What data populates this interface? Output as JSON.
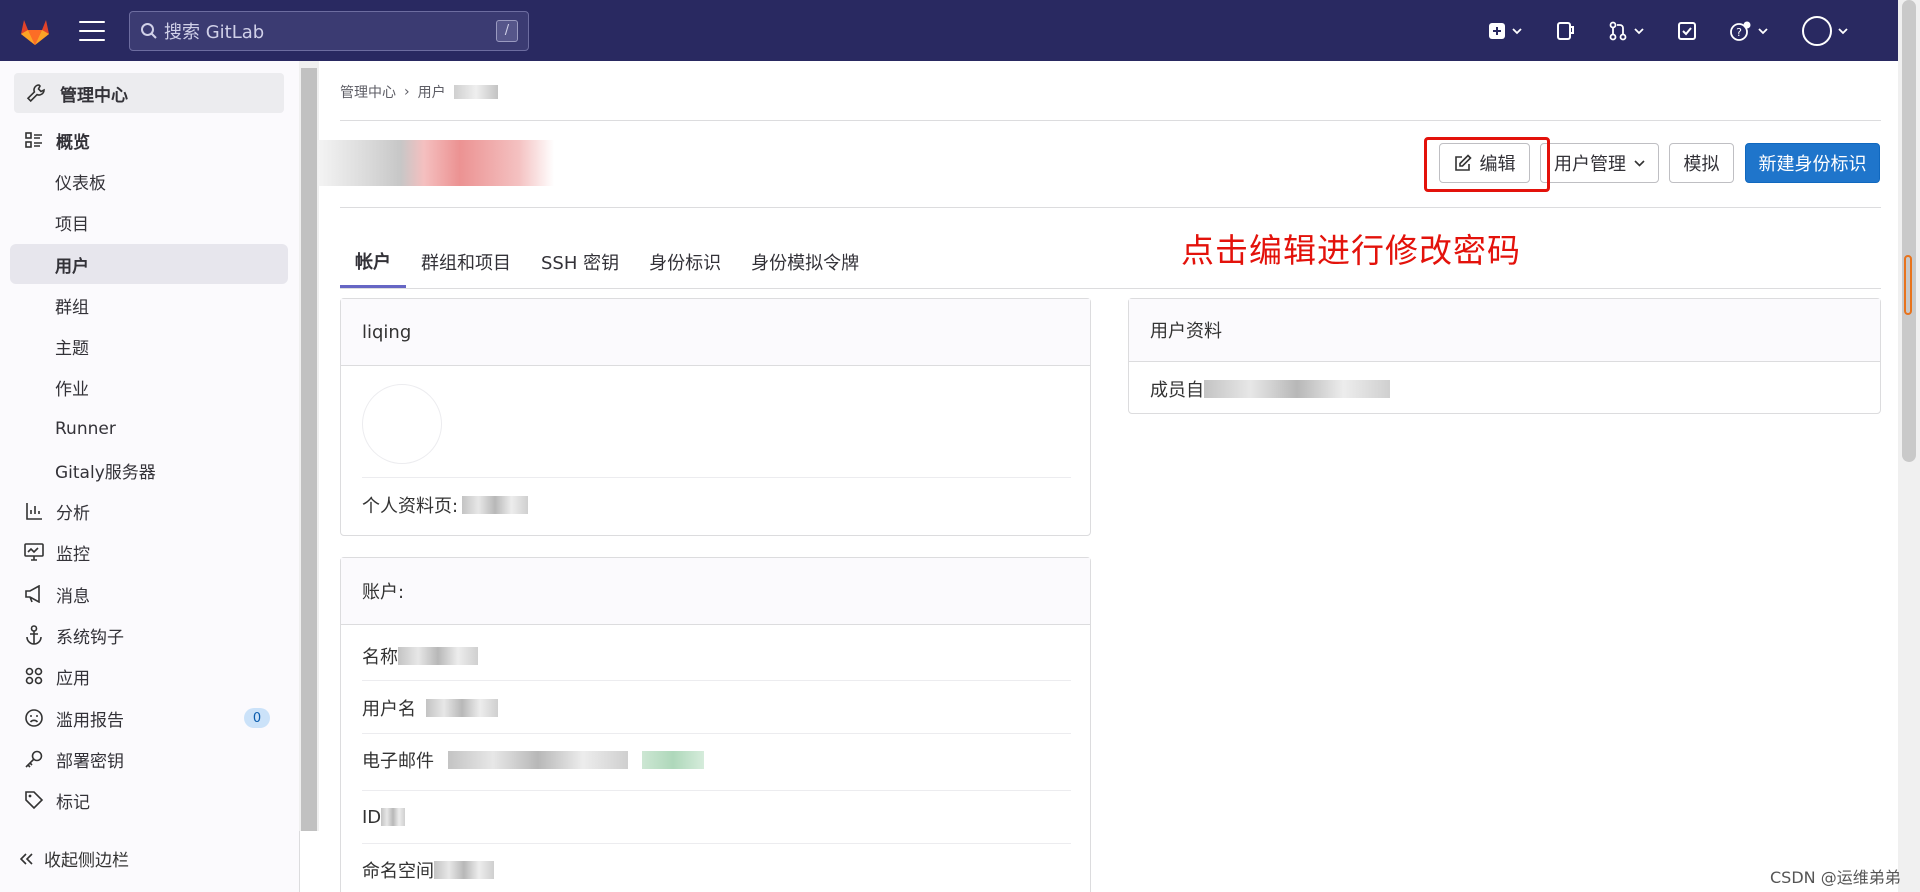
{
  "topbar": {
    "search_placeholder": "搜索 GitLab",
    "search_shortcut": "/"
  },
  "sidebar": {
    "header": "管理中心",
    "items": [
      {
        "label": "概览",
        "icon": "overview-icon",
        "section": true
      },
      {
        "label": "仪表板"
      },
      {
        "label": "项目"
      },
      {
        "label": "用户",
        "active": true
      },
      {
        "label": "群组"
      },
      {
        "label": "主题"
      },
      {
        "label": "作业"
      },
      {
        "label": "Runner"
      },
      {
        "label": "Gitaly服务器"
      },
      {
        "label": "分析",
        "icon": "analytics-icon",
        "section": true
      },
      {
        "label": "监控",
        "icon": "monitor-icon",
        "section": true
      },
      {
        "label": "消息",
        "icon": "megaphone-icon",
        "section": true
      },
      {
        "label": "系统钩子",
        "icon": "anchor-icon",
        "section": true
      },
      {
        "label": "应用",
        "icon": "apps-icon",
        "section": true
      },
      {
        "label": "滥用报告",
        "icon": "abuse-icon",
        "section": true,
        "badge": "0"
      },
      {
        "label": "部署密钥",
        "icon": "key-icon",
        "section": true
      },
      {
        "label": "标记",
        "icon": "label-icon",
        "section": true
      }
    ],
    "collapse_label": "收起侧边栏"
  },
  "breadcrumb": {
    "root": "管理中心",
    "sep": "›",
    "current": "用户"
  },
  "actions": {
    "edit": "编辑",
    "user_admin": "用户管理",
    "impersonate": "模拟",
    "new_identity": "新建身份标识"
  },
  "annotation": "点击编辑进行修改密码",
  "tabs": [
    "帐户",
    "群组和项目",
    "SSH 密钥",
    "身份标识",
    "身份模拟令牌"
  ],
  "profile_card": {
    "username": "liqing",
    "profile_label": "个人资料页:"
  },
  "account_card": {
    "title": "账户:",
    "fields": [
      "名称",
      "用户名",
      "电子邮件",
      "ID",
      "命名空间"
    ]
  },
  "user_info_card": {
    "title": "用户资料",
    "member_label": "成员自"
  },
  "watermark": "CSDN @运维弟弟",
  "colors": {
    "topbar": "#292961",
    "primary": "#1f75cb",
    "annotation": "#e3120b"
  }
}
